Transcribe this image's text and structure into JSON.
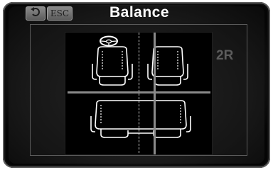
{
  "header": {
    "title": "Balance",
    "esc_label": "ESC",
    "back_icon": "undo-arrow-icon"
  },
  "diagram": {
    "row_label": "2R",
    "steering_icon": "steering-wheel-icon"
  },
  "colors": {
    "background": "#1b1b1b",
    "cabin": "#000000",
    "divider": "#8a8a8a",
    "seat_outline": "#ffffff",
    "muted_label": "#5c5c5c"
  }
}
